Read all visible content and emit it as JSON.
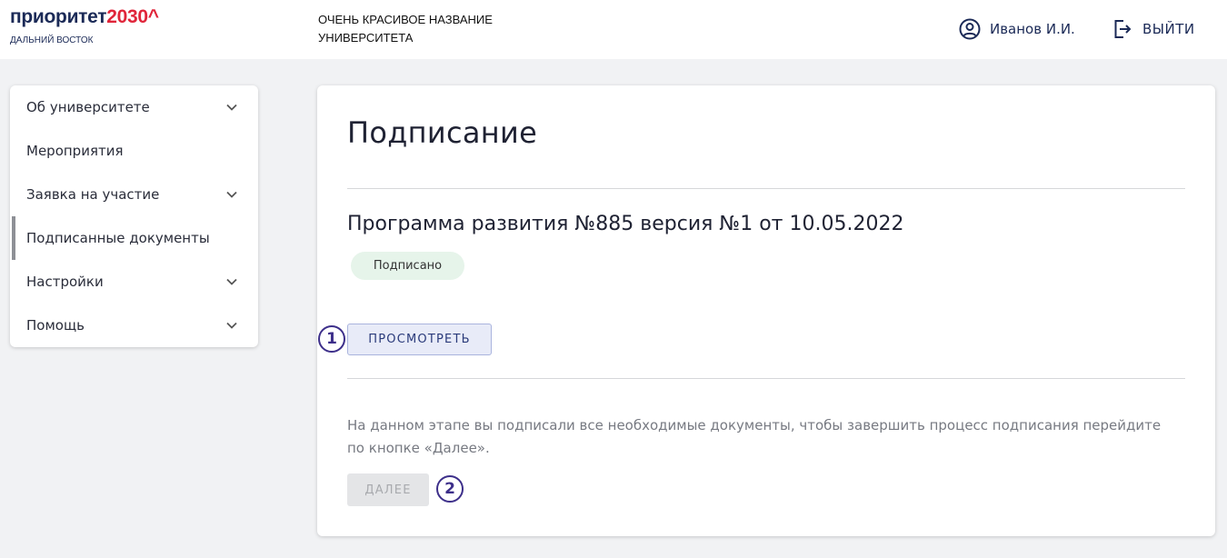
{
  "header": {
    "logo": {
      "main": "приоритет",
      "accent": "2030^",
      "sub": "ДАЛЬНИЙ ВОСТОК"
    },
    "university_name": "ОЧЕНЬ КРАСИВОЕ НАЗВАНИЕ УНИВЕРСИТЕТА",
    "user_name": "Иванов И.И.",
    "logout_label": "ВЫЙТИ",
    "colors": {
      "brand": "#1b2a57",
      "accent": "#e0253a"
    }
  },
  "sidebar": {
    "items": [
      {
        "label": "Об университете",
        "expandable": true,
        "active": false
      },
      {
        "label": "Мероприятия",
        "expandable": false,
        "active": false
      },
      {
        "label": "Заявка на участие",
        "expandable": true,
        "active": false
      },
      {
        "label": "Подписанные документы",
        "expandable": false,
        "active": true
      },
      {
        "label": "Настройки",
        "expandable": true,
        "active": false
      },
      {
        "label": "Помощь",
        "expandable": true,
        "active": false
      }
    ]
  },
  "main": {
    "title": "Подписание",
    "document_title": "Программа развития №885 версия №1 от 10.05.2022",
    "status_badge": "Подписано",
    "view_button_label": "ПРОСМОТРЕТЬ",
    "info_text": "На данном этапе вы подписали все необходимые документы, чтобы завершить процесс подписания перейдите по кнопке «Далее».",
    "next_button_label": "ДАЛЕЕ"
  },
  "annotations": {
    "marker_1": "1",
    "marker_2": "2"
  }
}
